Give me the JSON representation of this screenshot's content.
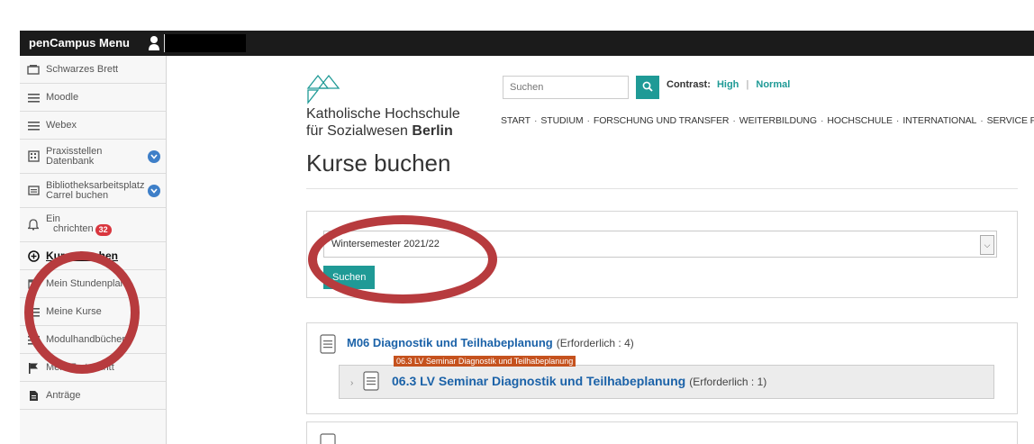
{
  "topbar": {
    "menu_title": "penCampus Menu"
  },
  "sidebar": {
    "items": [
      {
        "label": "Schwarzes Brett",
        "icon": "bulletin-board-icon"
      },
      {
        "label": "Moodle",
        "icon": "menu-lines-icon"
      },
      {
        "label": "Webex",
        "icon": "menu-lines-icon"
      },
      {
        "label": "Praxisstellen Datenbank",
        "icon": "building-icon"
      },
      {
        "label": "Bibliotheksarbeitsplatz Carrel buchen",
        "icon": "message-icon"
      },
      {
        "label": "Ein",
        "label2": "chrichten",
        "badge": "32",
        "icon": "bell-icon"
      },
      {
        "label": "Kurse buchen",
        "icon": "plus-circle-icon"
      },
      {
        "label": "Mein Stundenplan",
        "icon": "calendar-icon"
      },
      {
        "label": "Meine Kurse",
        "icon": "list-icon"
      },
      {
        "label": "Modulhandbücher",
        "icon": "menu-lines-icon"
      },
      {
        "label": "Mein Fortschritt",
        "icon": "flag-icon"
      },
      {
        "label": "Anträge",
        "icon": "document-icon"
      }
    ]
  },
  "header": {
    "logo_line1": "Katholische Hochschule",
    "logo_line2_prefix": "für Sozialwesen ",
    "logo_line2_bold": "Berlin",
    "search_placeholder": "Suchen",
    "contrast_label": "Contrast:",
    "contrast_high": "High",
    "contrast_sep": "|",
    "contrast_normal": "Normal",
    "nav": [
      "START",
      "STUDIUM",
      "FORSCHUNG UND TRANSFER",
      "WEITERBILDUNG",
      "HOCHSCHULE",
      "INTERNATIONAL",
      "SERVICE FÜR STUDIERENDE"
    ],
    "nav_sep": "·"
  },
  "main": {
    "page_title": "Kurse buchen",
    "semester_value": "Wintersemester 2021/22",
    "submit_label": "Suchen",
    "course": {
      "title": "M06 Diagnostik und Teilhabeplanung",
      "requirement": "(Erforderlich : 4)",
      "tooltip": "06.3 LV Seminar Diagnostik und Teilhabeplanung",
      "sub_title": "06.3 LV Seminar Diagnostik und Teilhabeplanung",
      "sub_requirement": "(Erforderlich : 1)"
    }
  },
  "colors": {
    "accent": "#1f9a96",
    "link": "#1b62a8",
    "annotation": "#b73b3e",
    "badge": "#d9363e"
  }
}
